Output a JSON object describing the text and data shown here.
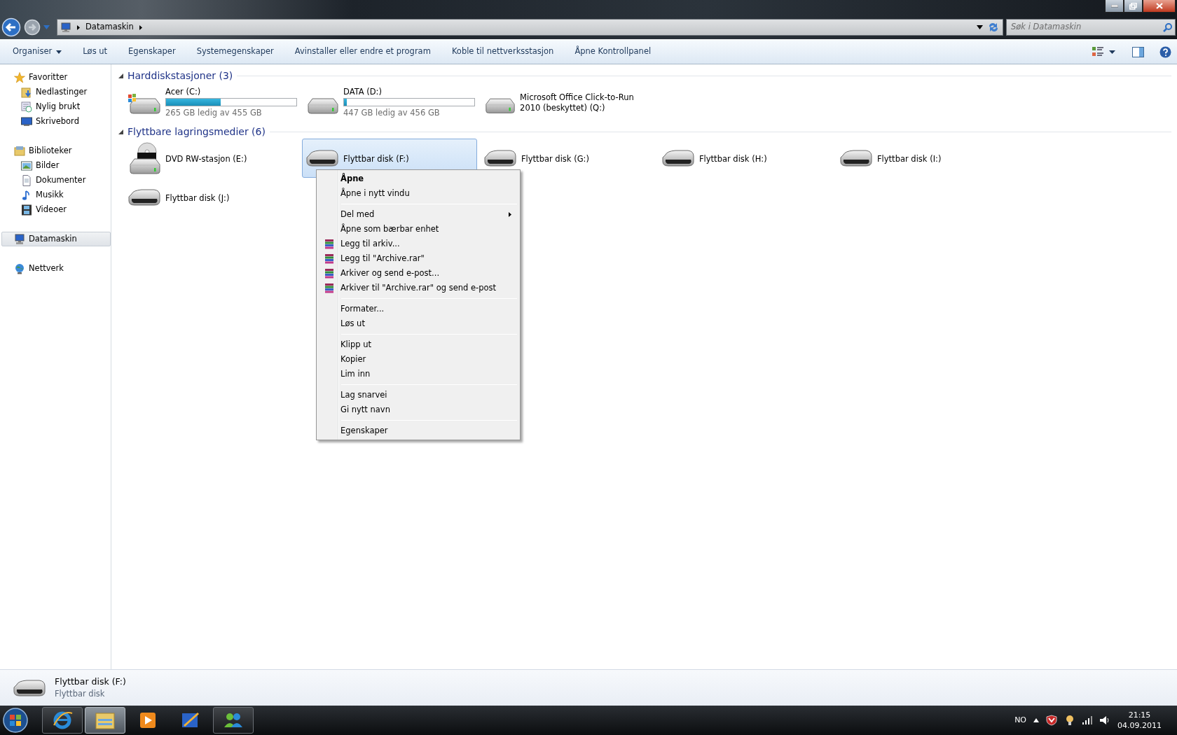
{
  "address_bar": {
    "breadcrumb": [
      "Datamaskin"
    ]
  },
  "search": {
    "placeholder": "Søk i Datamaskin"
  },
  "toolbar": [
    {
      "label": "Organiser",
      "dropdown": true
    },
    {
      "label": "Løs ut",
      "dropdown": false
    },
    {
      "label": "Egenskaper",
      "dropdown": false
    },
    {
      "label": "Systemegenskaper",
      "dropdown": false
    },
    {
      "label": "Avinstaller eller endre et program",
      "dropdown": false
    },
    {
      "label": "Koble til nettverksstasjon",
      "dropdown": false
    },
    {
      "label": "Åpne Kontrollpanel",
      "dropdown": false
    }
  ],
  "sidebar": [
    {
      "label": "Favoritter",
      "selected": false,
      "children": [
        {
          "label": "Nedlastinger",
          "selected": false
        },
        {
          "label": "Nylig brukt",
          "selected": false
        },
        {
          "label": "Skrivebord",
          "selected": false
        }
      ]
    },
    {
      "label": "Biblioteker",
      "selected": false,
      "children": [
        {
          "label": "Bilder",
          "selected": false
        },
        {
          "label": "Dokumenter",
          "selected": false
        },
        {
          "label": "Musikk",
          "selected": false
        },
        {
          "label": "Videoer",
          "selected": false
        }
      ]
    },
    {
      "label": "Datamaskin",
      "selected": true
    },
    {
      "label": "Nettverk",
      "selected": false
    }
  ],
  "sections": [
    {
      "title": "Harddiskstasjoner (3)",
      "expanded": true,
      "drives": [
        {
          "kind": "system",
          "name": "Acer (C:)",
          "free": "265 GB ledig av 455 GB",
          "level": 0.42,
          "selected": false
        },
        {
          "kind": "hdd",
          "name": "DATA (D:)",
          "free": "447 GB ledig av 456 GB",
          "level": 0.02,
          "selected": false
        },
        {
          "kind": "hdd",
          "name": "Microsoft Office Click-to-Run 2010 (beskyttet) (Q:)",
          "selected": false
        }
      ]
    },
    {
      "title": "Flyttbare lagringsmedier (6)",
      "expanded": true,
      "drives": [
        {
          "kind": "dvd",
          "name": "DVD RW-stasjon (E:)",
          "selected": false
        },
        {
          "kind": "usb",
          "name": "Flyttbar disk (F:)",
          "selected": true
        },
        {
          "kind": "usb",
          "name": "Flyttbar disk (G:)",
          "selected": false
        },
        {
          "kind": "usb",
          "name": "Flyttbar disk (H:)",
          "selected": false
        },
        {
          "kind": "usb",
          "name": "Flyttbar disk (I:)",
          "selected": false
        },
        {
          "kind": "usb",
          "name": "Flyttbar disk (J:)",
          "selected": false
        }
      ]
    }
  ],
  "context_menu": {
    "groups": [
      [
        {
          "label": "Åpne",
          "kind": "default"
        },
        {
          "label": "Åpne i nytt vindu",
          "kind": "plain"
        }
      ],
      [
        {
          "label": "Del med",
          "kind": "submenu"
        },
        {
          "label": "Åpne som bærbar enhet",
          "kind": "plain"
        },
        {
          "label": "Legg til arkiv...",
          "kind": "archive"
        },
        {
          "label": "Legg til \"Archive.rar\"",
          "kind": "archive"
        },
        {
          "label": "Arkiver og send e-post...",
          "kind": "archive"
        },
        {
          "label": "Arkiver til \"Archive.rar\" og send e-post",
          "kind": "archive"
        }
      ],
      [
        {
          "label": "Formater...",
          "kind": "plain"
        },
        {
          "label": "Løs ut",
          "kind": "plain"
        }
      ],
      [
        {
          "label": "Klipp ut",
          "kind": "plain"
        },
        {
          "label": "Kopier",
          "kind": "plain"
        },
        {
          "label": "Lim inn",
          "kind": "plain"
        }
      ],
      [
        {
          "label": "Lag snarvei",
          "kind": "plain"
        },
        {
          "label": "Gi nytt navn",
          "kind": "plain"
        }
      ],
      [
        {
          "label": "Egenskaper",
          "kind": "plain"
        }
      ]
    ]
  },
  "details": {
    "title": "Flyttbar disk (F:)",
    "subtitle": "Flyttbar disk"
  },
  "taskbar": {
    "apps": [
      {
        "running": true,
        "selected": false
      },
      {
        "running": true,
        "selected": true
      },
      {
        "running": false,
        "selected": false
      },
      {
        "running": false,
        "selected": false
      },
      {
        "running": true,
        "selected": false
      }
    ],
    "language": "NO",
    "time": "21:15",
    "date": "04.09.2011"
  }
}
